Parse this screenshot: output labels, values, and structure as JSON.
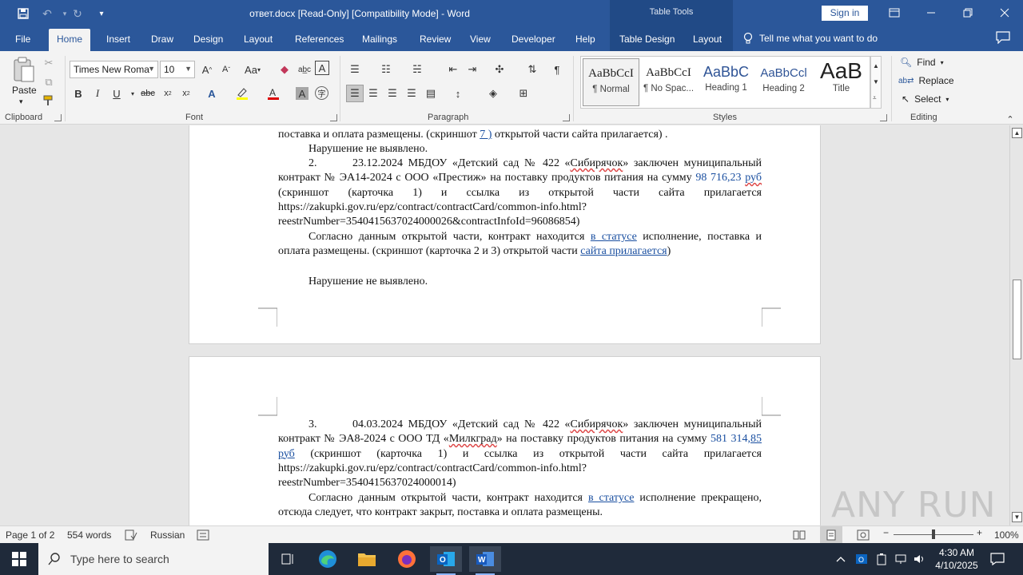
{
  "titlebar": {
    "title": "ответ.docx [Read-Only] [Compatibility Mode]  -  Word",
    "context_tab_header": "Table Tools",
    "signin_label": "Sign in"
  },
  "tabs": {
    "file": "File",
    "home": "Home",
    "insert": "Insert",
    "draw": "Draw",
    "design": "Design",
    "layout": "Layout",
    "references": "References",
    "mailings": "Mailings",
    "review": "Review",
    "view": "View",
    "developer": "Developer",
    "help": "Help",
    "table_design": "Table Design",
    "table_layout": "Layout",
    "tell_me": "Tell me what you want to do"
  },
  "ribbon": {
    "clipboard": {
      "paste": "Paste",
      "label": "Clipboard"
    },
    "font": {
      "name": "Times New Roma",
      "size": "10",
      "label": "Font",
      "size_case": "Aa"
    },
    "paragraph": {
      "label": "Paragraph"
    },
    "styles": {
      "label": "Styles",
      "items": [
        {
          "preview": "AaBbCcI",
          "name": "¶ Normal"
        },
        {
          "preview": "AaBbCcI",
          "name": "¶ No Spac..."
        },
        {
          "preview": "AaBbC",
          "name": "Heading 1"
        },
        {
          "preview": "AaBbCcl",
          "name": "Heading 2"
        },
        {
          "preview": "AaB",
          "name": "Title"
        }
      ]
    },
    "editing": {
      "find": "Find",
      "replace": "Replace",
      "select": "Select",
      "label": "Editing"
    }
  },
  "document": {
    "p1_line": "поставка и оплата размещены. (скриншот ",
    "p1_link": "7 )",
    "p1_rest": " открытой части сайта  прилагается) .",
    "p2": "Нарушение не выявлено.",
    "item2": {
      "num": "2.",
      "date": "23.12.2024",
      "text_a": "МБДОУ «Детский сад № 422 «",
      "name": "Сибирячок",
      "text_b": "» заключен муниципальный контракт № ЭА14-2024 с ООО «Престиж» на поставку продуктов питания на сумму ",
      "sum": "98 716,23",
      "cur": "руб",
      "text_c": " (скриншот (карточка 1) и ссылка из открытой части сайта прилагается https://zakupki.gov.ru/epz/contract/contractCard/common-info.html?reestrNumber=3540415637024000026&contractInfoId=96086854)"
    },
    "p3_a": "Согласно данным открытой части, контракт находится ",
    "p3_link": "в   статусе",
    "p3_b": " исполнение, поставка и оплата размещены. (скриншот (карточка 2 и 3) открытой части ",
    "p3_link2": "сайта  прилагается",
    "p3_c": ")",
    "p4": "Нарушение не выявлено.",
    "item3": {
      "num": "3.",
      "date": "04.03.2024",
      "text_a": "МБДОУ «Детский сад № 422 «",
      "name": "Сибирячок",
      "text_b": "» заключен муниципальный контракт № ЭА8-2024 с ООО ТД «",
      "name2": "Милкград",
      "text_c": "» на поставку продуктов питания на сумму ",
      "sum": "581 314,",
      "sum2": "85  руб",
      "text_d": " (скриншот (карточка 1) и ссылка из открытой части сайта прилагается https://zakupki.gov.ru/epz/contract/contractCard/common-info.html?reestrNumber=3540415637024000014)"
    },
    "p5_a": "Согласно данным открытой части, контракт находится ",
    "p5_link": "в   статусе",
    "p5_b": " исполнение прекращено, отсюда следует, что контракт закрыт, поставка и оплата размещены."
  },
  "statusbar": {
    "page": "Page 1 of 2",
    "words": "554 words",
    "language": "Russian",
    "zoom": "100%"
  },
  "taskbar": {
    "search_placeholder": "Type here to search",
    "time": "4:30 AM",
    "date": "4/10/2025"
  },
  "watermark": "ANY RUN"
}
